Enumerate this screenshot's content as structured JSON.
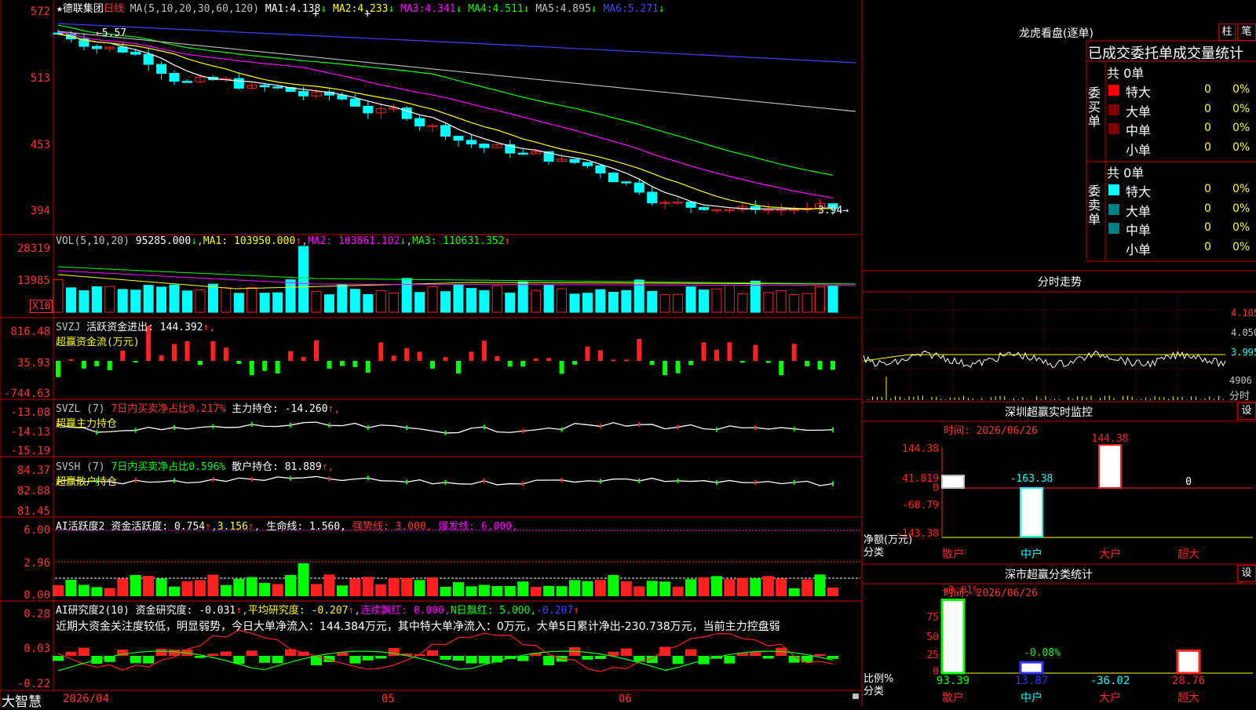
{
  "colors": {
    "up": "#ff2020",
    "down": "#00ffff",
    "grid": "#c00000",
    "yellow": "#ffff00",
    "magenta": "#ff00ff",
    "green": "#00ff00",
    "white": "#ffffff",
    "blue": "#4040ff",
    "gray": "#c0c0c0"
  },
  "stock": {
    "name": "德联集团",
    "period": "日线",
    "ma_label": "MA(5,10,20,30,60,120)",
    "ma": [
      {
        "label": "MA1:",
        "val": "4.138",
        "arrow": "↓"
      },
      {
        "label": "MA2:",
        "val": "4.233",
        "arrow": "↓"
      },
      {
        "label": "MA3:",
        "val": "4.341",
        "arrow": "↓"
      },
      {
        "label": "MA4:",
        "val": "4.511",
        "arrow": "↓"
      },
      {
        "label": "MA5:",
        "val": "4.895",
        "arrow": "↓"
      },
      {
        "label": "MA6:",
        "val": "5.271",
        "arrow": "↓"
      }
    ],
    "high_mark": "←5.57",
    "low_mark": "3.94→"
  },
  "y_axes": {
    "price": [
      "572",
      "513",
      "453",
      "394"
    ],
    "vol": [
      "28319",
      "13985"
    ],
    "vol_unit": "X10",
    "svzj": [
      "816.48",
      "35.93",
      "-744.63"
    ],
    "svzl": [
      "-13.08",
      "-14.13",
      "-15.19"
    ],
    "svsh": [
      "84.37",
      "82.88",
      "81.45"
    ],
    "ai1": [
      "6.00",
      "2.96",
      "0.00"
    ],
    "ai2": [
      "0.28",
      "0.03",
      "-0.22"
    ]
  },
  "vol_panel": {
    "label": "VOL(5,10,20)",
    "val": "95285.000",
    "ma": [
      {
        "label": "MA1:",
        "val": "103950.000",
        "arrow": "↑"
      },
      {
        "label": "MA2:",
        "val": "103861.102",
        "arrow": "↓"
      },
      {
        "label": "MA3:",
        "val": "110631.352",
        "arrow": "↑"
      }
    ]
  },
  "svzj_panel": {
    "label": "SVZJ",
    "text": "活跃资金进出:",
    "val": "144.392",
    "arrow": "↑,",
    "sub": "超赢资金流(万元)"
  },
  "svzl_panel": {
    "label": "SVZL (7)",
    "green_text": "7日内买卖净占比0.217%",
    "text": "主力持仓:",
    "val": "-14.260",
    "arrow": "↑,",
    "sub": "超赢主力持仓"
  },
  "svsh_panel": {
    "label": "SVSH (7)",
    "green_text": "7日内买卖净占比0.596%",
    "text": "散户持仓:",
    "val": "81.889",
    "arrow": "↑,",
    "sub": "超赢散户持仓"
  },
  "ai1_panel": {
    "label": "AI活跃度2",
    "text": "资金活跃度:",
    "v1": "0.754",
    "v2": "3.156",
    "life": "生命线:",
    "v3": "1.560,",
    "strong": "强势线:",
    "v4": "3.000,",
    "burst": "爆发线:",
    "v5": "6.000,"
  },
  "ai2_panel": {
    "label": "AI研究度2(10)",
    "text": "资金研究度:",
    "v1": "-0.031",
    "avg": "平均研究度:",
    "v2": "-0.207",
    "cont": "连续飘红:",
    "v3": "0.000,",
    "nday": "N日飘红:",
    "v4": "5.000,",
    "v5": "-0.207",
    "desc": "近期大资金关注度较低，明显弱势，今日大单净流入：144.384万元，其中特大单净流入：0万元，大单5日累计净出-230.738万元，当前主力控盘弱"
  },
  "x_axis": {
    "brand": "大智慧",
    "dates": [
      "2026/04",
      "05",
      "06"
    ]
  },
  "right": {
    "lhb_title": "龙虎看盘(逐单)",
    "btn_zhu": "柱",
    "btn_bi": "笔",
    "stat_title": "已成交委托单成交量统计",
    "buy": {
      "side": "委买单",
      "total": "共 0单",
      "rows": [
        {
          "label": "特大",
          "n": "0",
          "p": "0%",
          "color": "#ff0000"
        },
        {
          "label": "大单",
          "n": "0",
          "p": "0%",
          "color": "#800000"
        },
        {
          "label": "中单",
          "n": "0",
          "p": "0%",
          "color": "#800000"
        },
        {
          "label": "小单",
          "n": "0",
          "p": "0%",
          "color": ""
        }
      ]
    },
    "sell": {
      "side": "委卖单",
      "total": "共 0单",
      "rows": [
        {
          "label": "特大",
          "n": "0",
          "p": "0%",
          "color": "#00ffff"
        },
        {
          "label": "大单",
          "n": "0",
          "p": "0%",
          "color": "#008080"
        },
        {
          "label": "中单",
          "n": "0",
          "p": "0%",
          "color": "#008080"
        },
        {
          "label": "小单",
          "n": "0",
          "p": "0%",
          "color": ""
        }
      ]
    },
    "intraday": {
      "title": "分时走势",
      "prices": [
        "4.105",
        "4.050",
        "3.995"
      ],
      "vol": "4906",
      "vol_label": "分时"
    },
    "monitor": {
      "title": "深圳超赢实时监控",
      "btn": "设",
      "time": "时间: 2026/06/26",
      "ylabels": [
        "144.38",
        "41.819",
        "0",
        "-60.79",
        "-143.38"
      ],
      "ylabel": "净额(万元)",
      "xlabel": "分类",
      "cats": [
        "散户",
        "中户",
        "大户",
        "超大"
      ],
      "values": [
        41.819,
        -163.38,
        144.38,
        0
      ],
      "vlabels": [
        "",
        "-163.38",
        "144.38",
        "0"
      ]
    },
    "classify": {
      "title": "深市超赢分类统计",
      "btn": "设",
      "time": "时间: 2026/06/26",
      "ylabels": [
        "75",
        "50",
        "25",
        "0"
      ],
      "ylabel": "比例%",
      "xlabel": "分类",
      "cats": [
        "散户",
        "中户",
        "大户",
        "超大"
      ],
      "values": [
        93.39,
        13.87,
        -36.02,
        28.76
      ],
      "tops": [
        "+0.01%",
        "-0.08%",
        "",
        ""
      ],
      "vlabels": [
        "93.39",
        "13.87",
        "-36.02",
        "28.76"
      ]
    }
  }
}
